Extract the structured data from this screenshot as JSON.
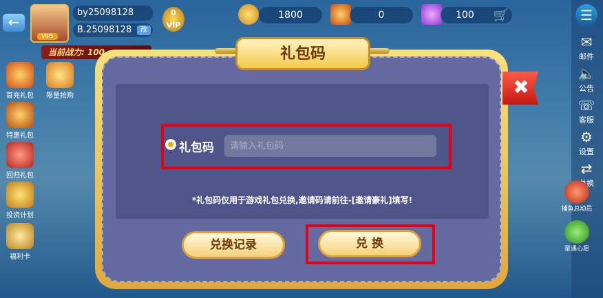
{
  "top_bar": {
    "back_icon": "back-arrow-icon",
    "avatar_badge": "VIP5",
    "user_id": "by25098128",
    "nickname": "B.25098128",
    "edit_label": "改",
    "vip_level": "0",
    "vip_label": "VIP",
    "battle_power": "当前战力: 100",
    "resources": [
      {
        "name": "gold",
        "icon": "gold-coin-icon",
        "value": "1800"
      },
      {
        "name": "ticket",
        "icon": "lottery-ticket-icon",
        "value": "0"
      },
      {
        "name": "diamond",
        "icon": "diamond-icon",
        "value": "100"
      }
    ],
    "cart_icon": "shopping-cart-icon"
  },
  "left_menu": [
    {
      "label": "首充礼包",
      "icon": "gift-icon"
    },
    {
      "label": "限量抢购",
      "icon": "flash-sale-icon"
    },
    {
      "label": "特惠礼包",
      "icon": "special-gift-icon"
    },
    {
      "label": "回归礼包",
      "icon": "return-gift-icon"
    },
    {
      "label": "投资计划",
      "icon": "investment-icon"
    },
    {
      "label": "福利卡",
      "icon": "welfare-card-icon"
    }
  ],
  "right_sidebar": [
    {
      "label": "邮件",
      "icon": "mail-icon"
    },
    {
      "label": "公告",
      "icon": "speaker-icon"
    },
    {
      "label": "客服",
      "icon": "headset-icon"
    },
    {
      "label": "设置",
      "icon": "gear-icon"
    },
    {
      "label": "兑换",
      "icon": "exchange-icon"
    }
  ],
  "right_games": [
    {
      "label": "捕鱼总动员"
    },
    {
      "label": "星遇心愿"
    }
  ],
  "dialog": {
    "title": "礼包码",
    "code_label": "礼包码",
    "code_value": "",
    "code_placeholder": "请输入礼包码",
    "note": "*礼包码仅用于游戏礼包兑换,邀请码请前往-[邀请豪礼]填写!",
    "history_button": "兑换记录",
    "redeem_button": "兑 换",
    "close_icon": "close-icon"
  },
  "colors": {
    "highlight": "#e60012",
    "dialog_bg": "#646aa0",
    "gold_frame": "#f0c250",
    "button_text": "#6b3a07"
  }
}
